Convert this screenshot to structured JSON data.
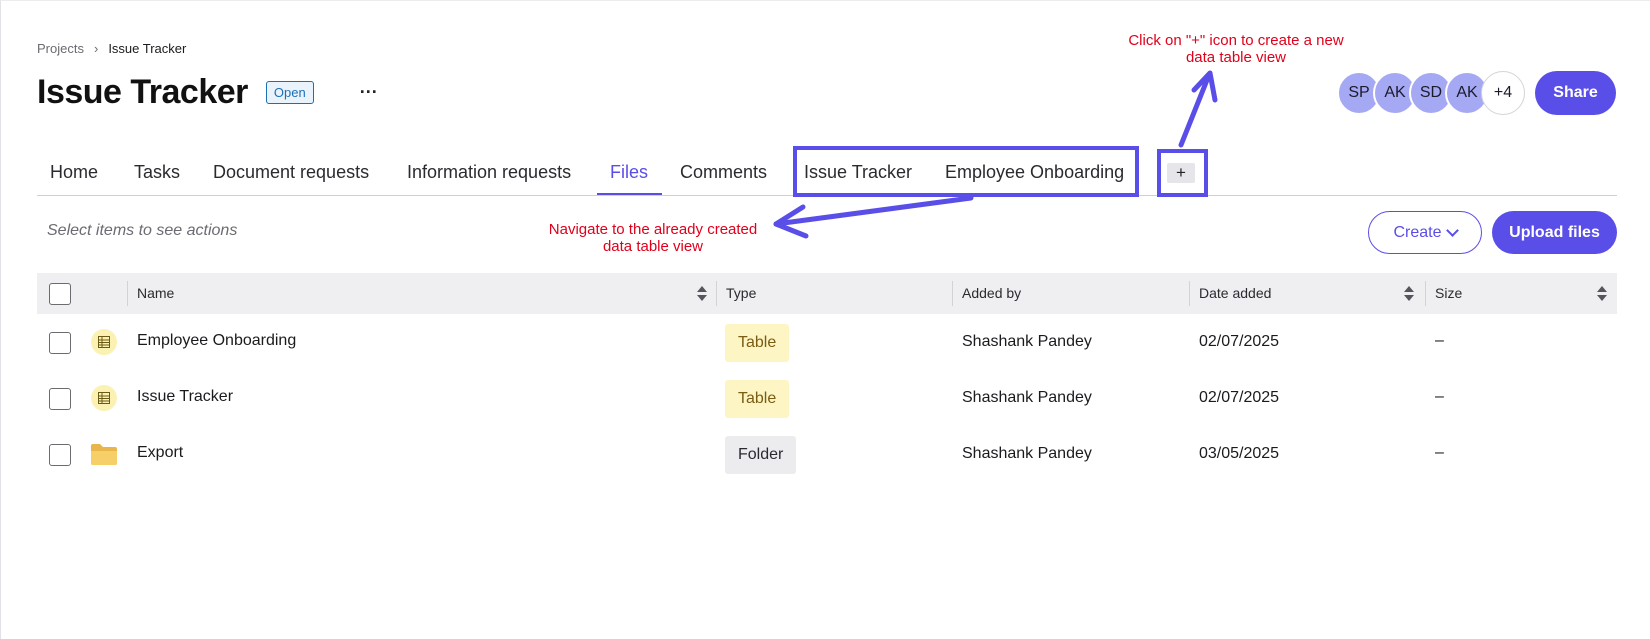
{
  "breadcrumb": {
    "parent": "Projects",
    "separator": "›",
    "current": "Issue Tracker"
  },
  "header": {
    "title": "Issue Tracker",
    "status": "Open",
    "more": "···"
  },
  "collaborators": {
    "avatars": [
      "SP",
      "AK",
      "SD",
      "AK"
    ],
    "overflow": "+4"
  },
  "share_label": "Share",
  "tabs": [
    {
      "label": "Home"
    },
    {
      "label": "Tasks"
    },
    {
      "label": "Document requests"
    },
    {
      "label": "Information requests"
    },
    {
      "label": "Files",
      "active": true
    },
    {
      "label": "Comments"
    },
    {
      "label": "Issue Tracker"
    },
    {
      "label": "Employee Onboarding"
    }
  ],
  "add_tab_label": "+",
  "toolbar": {
    "hint": "Select items to see actions",
    "create_label": "Create",
    "upload_label": "Upload files"
  },
  "table": {
    "columns": [
      "Name",
      "Type",
      "Added by",
      "Date added",
      "Size"
    ],
    "rows": [
      {
        "name": "Employee Onboarding",
        "icon": "table-icon",
        "type": "Table",
        "added_by": "Shashank Pandey",
        "date": "02/07/2025",
        "size": "–"
      },
      {
        "name": "Issue Tracker",
        "icon": "table-icon",
        "type": "Table",
        "added_by": "Shashank Pandey",
        "date": "02/07/2025",
        "size": "–"
      },
      {
        "name": "Export",
        "icon": "folder-icon",
        "type": "Folder",
        "added_by": "Shashank Pandey",
        "date": "03/05/2025",
        "size": "–"
      }
    ]
  },
  "annotations": {
    "plus_line1": "Click on \"+\" icon to create a new",
    "plus_line2": "data table view",
    "nav_line1": "Navigate to the already created",
    "nav_line2": "data table view"
  },
  "colors": {
    "accent": "#5a4ee8",
    "annotation": "#e0001b",
    "status": "#1c6fb5"
  }
}
